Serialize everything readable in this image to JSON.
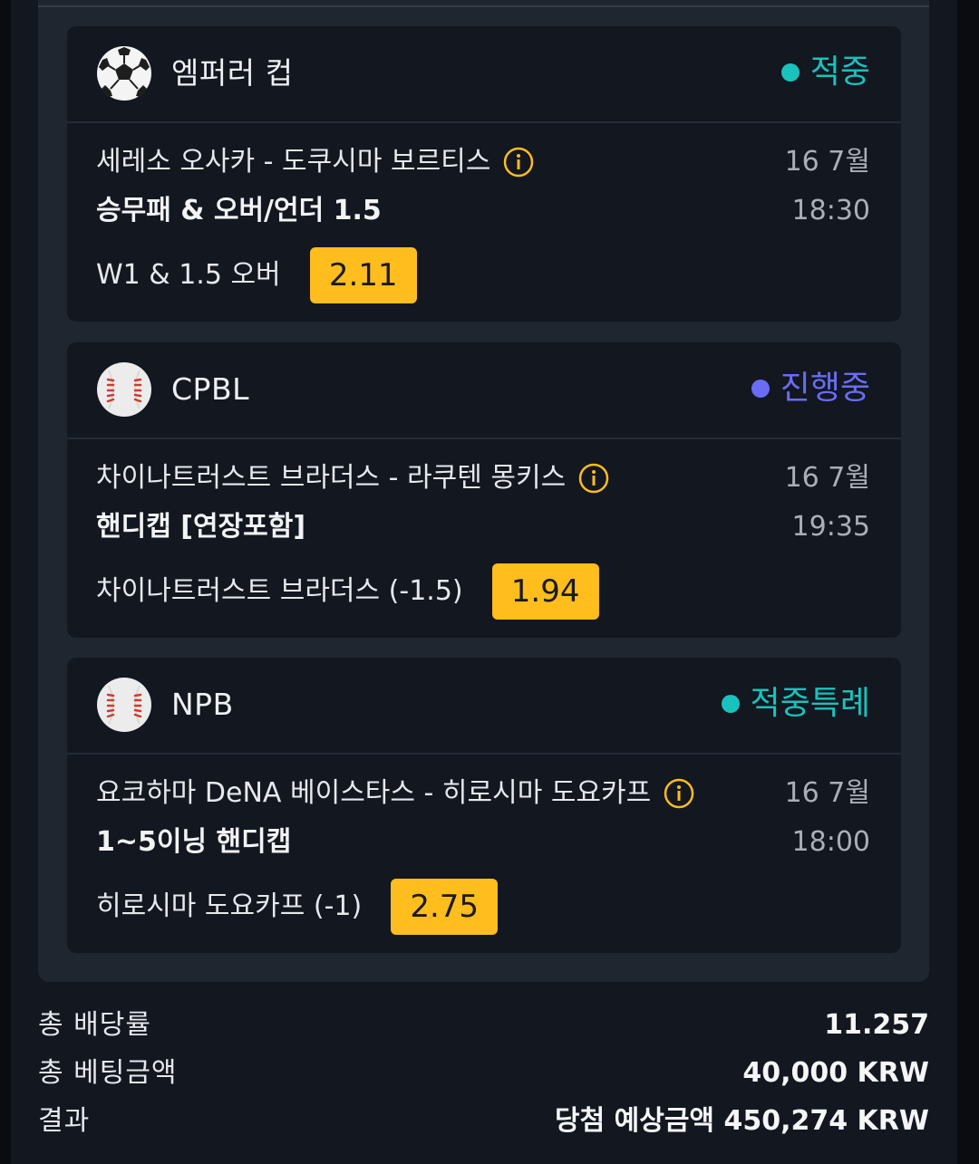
{
  "colors": {
    "status_won": "#19c2bd",
    "status_live": "#6a6cf5",
    "odds_bg": "#ffbd1e"
  },
  "bets": [
    {
      "sport_icon": "soccer-ball-icon",
      "league": "엠퍼러 컵",
      "status": "적중",
      "status_color": "#19c2bd",
      "match": "세레소 오사카 - 도쿠시마 보르티스",
      "market": "승무패 & 오버/언더 1.5",
      "date": "16 7월",
      "time": "18:30",
      "pick": "W1 & 1.5 오버",
      "odds": "2.11"
    },
    {
      "sport_icon": "baseball-icon",
      "league": "CPBL",
      "status": "진행중",
      "status_color": "#6a6cf5",
      "match": "차이나트러스트 브라더스 - 라쿠텐 몽키스",
      "market": "핸디캡 [연장포함]",
      "date": "16 7월",
      "time": "19:35",
      "pick": "차이나트러스트 브라더스 (-1.5)",
      "odds": "1.94"
    },
    {
      "sport_icon": "baseball-icon",
      "league": "NPB",
      "status": "적중특례",
      "status_color": "#19c2bd",
      "match": "요코하마 DeNA 베이스타스 - 히로시마 도요카프",
      "market": "1~5이닝 핸디캡",
      "date": "16 7월",
      "time": "18:00",
      "pick": "히로시마 도요카프 (-1)",
      "odds": "2.75"
    }
  ],
  "summary": {
    "total_odds_label": "총 배당률",
    "total_odds_value": "11.257",
    "total_stake_label": "총 베팅금액",
    "total_stake_value": "40,000 KRW",
    "result_label": "결과",
    "result_value": "당첨 예상금액 450,274 KRW"
  }
}
